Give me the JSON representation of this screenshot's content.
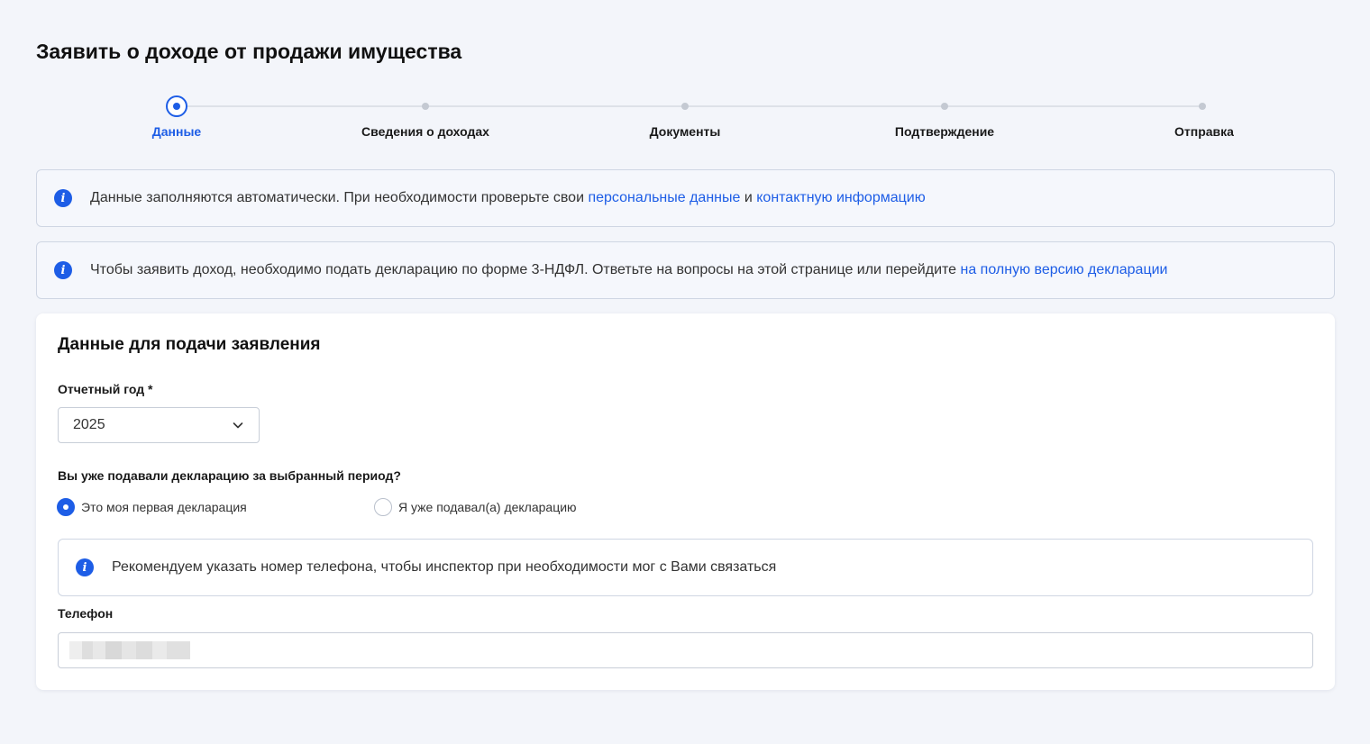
{
  "page": {
    "title": "Заявить о доходе от продажи имущества"
  },
  "stepper": {
    "steps": [
      {
        "label": "Данные",
        "active": true
      },
      {
        "label": "Сведения о доходах",
        "active": false
      },
      {
        "label": "Документы",
        "active": false
      },
      {
        "label": "Подтверждение",
        "active": false
      },
      {
        "label": "Отправка",
        "active": false
      }
    ]
  },
  "banners": [
    {
      "text_before": "Данные заполняются автоматически. При необходимости проверьте свои ",
      "link1": "персональные данные",
      "text_between": " и ",
      "link2": "контактную информацию"
    },
    {
      "text_before": "Чтобы заявить доход, необходимо подать декларацию по форме 3-НДФЛ. Ответьте на вопросы на этой странице или перейдите ",
      "link1": "на полную версию декларации"
    }
  ],
  "form": {
    "title": "Данные для подачи заявления",
    "year_label": "Отчетный год *",
    "year_value": "2025",
    "question": "Вы уже подавали декларацию за выбранный период?",
    "options": [
      {
        "label": "Это моя первая декларация",
        "checked": true
      },
      {
        "label": "Я уже подавал(а) декларацию",
        "checked": false
      }
    ],
    "phone_hint": "Рекомендуем указать номер телефона, чтобы инспектор при необходимости мог с Вами связаться",
    "phone_label": "Телефон"
  },
  "icons": {
    "info": "info-icon",
    "chevron": "chevron-down-icon",
    "info_glyph": "i"
  },
  "colors": {
    "accent": "#1d5de6",
    "background": "#f3f5fa",
    "banner_bg": "#f5f7fc",
    "border": "#cfd6e3"
  }
}
